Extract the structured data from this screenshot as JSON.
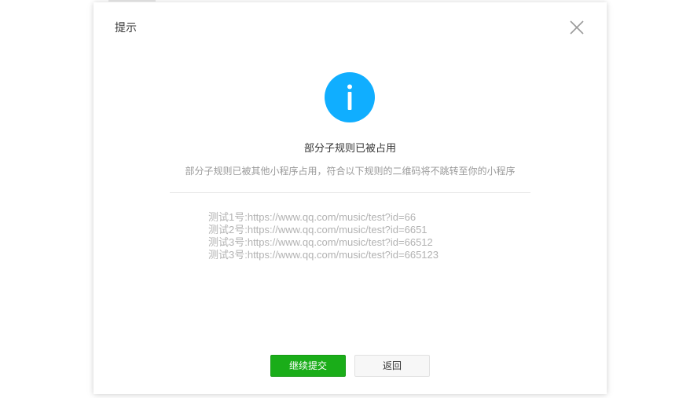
{
  "dialog": {
    "title": "提示",
    "icon": "info-icon",
    "accent_color": "#10aeff",
    "message_title": "部分子规则已被占用",
    "message_desc": "部分子规则已被其他小程序占用，符合以下规则的二维码将不跳转至你的小程序",
    "rules": [
      "测试1号:https://www.qq.com/music/test?id=66",
      "测试2号:https://www.qq.com/music/test?id=6651",
      "测试3号:https://www.qq.com/music/test?id=66512",
      "测试3号:https://www.qq.com/music/test?id=665123"
    ],
    "buttons": {
      "primary_label": "继续提交",
      "primary_color": "#1aad19",
      "secondary_label": "返回"
    }
  }
}
